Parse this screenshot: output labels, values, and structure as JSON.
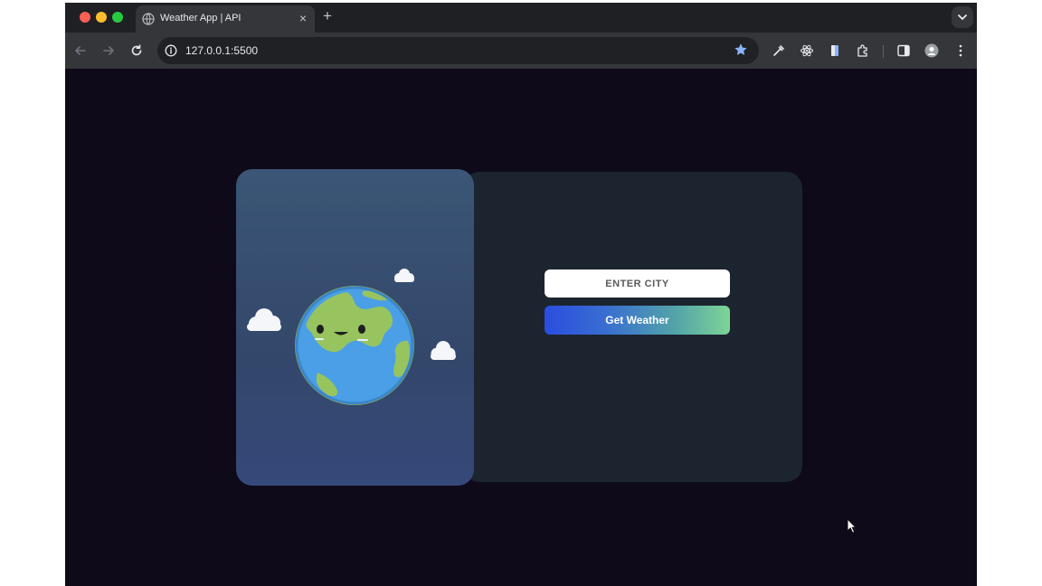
{
  "browser": {
    "tab": {
      "title": "Weather App | API"
    },
    "address_bar": {
      "url": "127.0.0.1:5500"
    }
  },
  "page": {
    "search": {
      "placeholder": "ENTER CITY",
      "value": ""
    },
    "button": {
      "label": "Get Weather"
    }
  },
  "colors": {
    "page_background": "#0e0a1a",
    "button_gradient_start": "#2a4de0",
    "button_gradient_end": "#7ed496",
    "panel_left": "#3b5676",
    "panel_right": "#1c2430"
  }
}
